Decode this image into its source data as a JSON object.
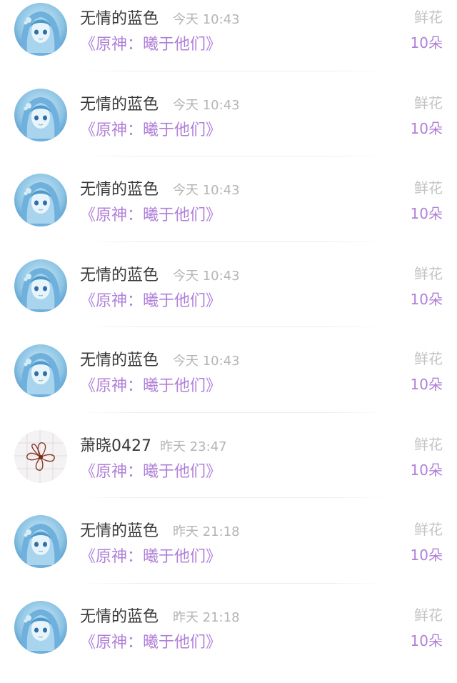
{
  "items": [
    {
      "username": "无情的蓝色",
      "time": "今天 10:43",
      "book_title": "《原神：曦于他们》",
      "gift_type": "鲜花",
      "gift_count": "10朵",
      "avatar": "anime-girl-avatar"
    },
    {
      "username": "无情的蓝色",
      "time": "今天 10:43",
      "book_title": "《原神：曦于他们》",
      "gift_type": "鲜花",
      "gift_count": "10朵",
      "avatar": "anime-girl-avatar"
    },
    {
      "username": "无情的蓝色",
      "time": "今天 10:43",
      "book_title": "《原神：曦于他们》",
      "gift_type": "鲜花",
      "gift_count": "10朵",
      "avatar": "anime-girl-avatar"
    },
    {
      "username": "无情的蓝色",
      "time": "今天 10:43",
      "book_title": "《原神：曦于他们》",
      "gift_type": "鲜花",
      "gift_count": "10朵",
      "avatar": "anime-girl-avatar"
    },
    {
      "username": "无情的蓝色",
      "time": "今天 10:43",
      "book_title": "《原神：曦于他们》",
      "gift_type": "鲜花",
      "gift_count": "10朵",
      "avatar": "anime-girl-avatar"
    },
    {
      "username": "萧晓0427",
      "time": "昨天 23:47",
      "book_title": "《原神：曦于他们》",
      "gift_type": "鲜花",
      "gift_count": "10朵",
      "avatar": "flower-sketch-avatar"
    },
    {
      "username": "无情的蓝色",
      "time": "昨天 21:18",
      "book_title": "《原神：曦于他们》",
      "gift_type": "鲜花",
      "gift_count": "10朵",
      "avatar": "anime-girl-avatar"
    },
    {
      "username": "无情的蓝色",
      "time": "昨天 21:18",
      "book_title": "《原神：曦于他们》",
      "gift_type": "鲜花",
      "gift_count": "10朵",
      "avatar": "anime-girl-avatar"
    }
  ],
  "colors": {
    "accent_purple": "#b080d8",
    "username_text": "#3a3a3a",
    "muted_gray": "#b4b4b4",
    "gift_type_gray": "#c4c4c4",
    "avatar_blue": "#5aa8d8"
  }
}
